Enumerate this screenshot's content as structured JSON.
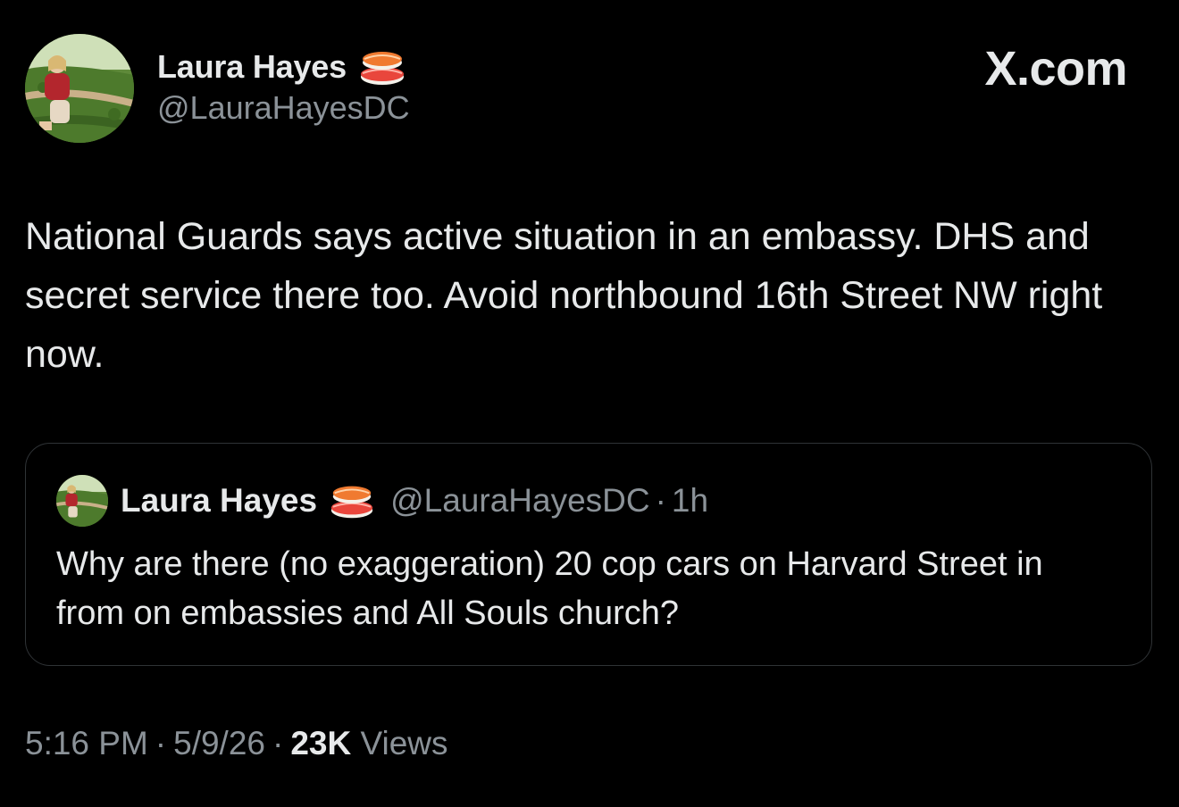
{
  "author": {
    "display_name": "Laura Hayes",
    "handle": "@LauraHayesDC",
    "badge_emoji": "sushi-icon"
  },
  "brand": "X.com",
  "tweet": {
    "text": "National Guards says active situation in an embassy. DHS and secret service there too. Avoid northbound 16th Street NW right now."
  },
  "quoted_tweet": {
    "display_name": "Laura Hayes",
    "handle": "@LauraHayesDC",
    "separator": "·",
    "time_ago": "1h",
    "text": "Why are there (no exaggeration) 20 cop cars on Harvard Street in from on embassies and All Souls church?"
  },
  "meta": {
    "time": "5:16 PM",
    "date": "5/9/26",
    "separator": "·",
    "views_count": "23K",
    "views_label": "Views"
  },
  "colors": {
    "background": "#000000",
    "text_primary": "#e7e9ea",
    "text_secondary": "#8b9298",
    "border": "#2f3336"
  }
}
